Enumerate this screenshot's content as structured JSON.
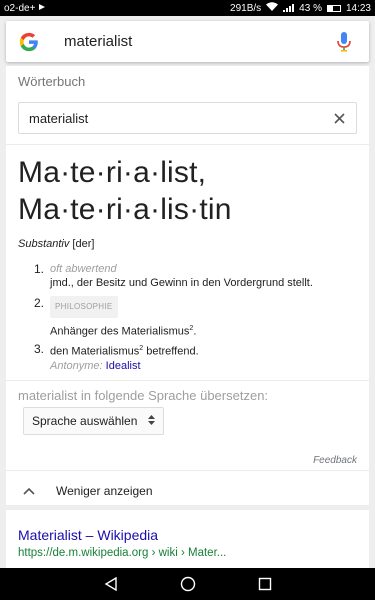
{
  "statusbar": {
    "carrier": "o2-de+",
    "speed": "291B/s",
    "battery": "43 %",
    "battery_level": 0.43,
    "time": "14:23"
  },
  "search": {
    "query": "materialist",
    "logo_icon": "google-g-icon",
    "mic_icon": "mic-icon"
  },
  "dictionary": {
    "label": "Wörterbuch",
    "input_value": "materialist",
    "headword_line1": "Ma·te·ri·a·list,",
    "headword_line2": "Ma·te·ri·a·lis·tin",
    "pos_italic": "Substantiv",
    "pos_gender": " [der]",
    "senses": [
      {
        "num": "1.",
        "label": "oft abwertend",
        "text": "jmd., der Besitz und Gewinn in den Vordergrund stellt."
      },
      {
        "num": "2.",
        "tag": "PHILOSOPHIE",
        "text": "Anhänger des Materialismus",
        "sup": "2",
        "text_end": "."
      },
      {
        "num": "3.",
        "text": "den Materialismus",
        "sup": "2",
        "text_end": " betreffend.",
        "antonym_label": "Antonyme:",
        "antonym": "Idealist"
      }
    ],
    "translate_label": "materialist in folgende Sprache übersetzen:",
    "select_value": "Sprache auswählen",
    "feedback": "Feedback",
    "less_label": "Weniger anzeigen"
  },
  "result": {
    "title": "Materialist – Wikipedia",
    "url": "https://de.m.wikipedia.org › wiki › Mater..."
  },
  "colors": {
    "link": "#1a0dab",
    "url_green": "#188038",
    "mic_blue": "#4285F4"
  }
}
